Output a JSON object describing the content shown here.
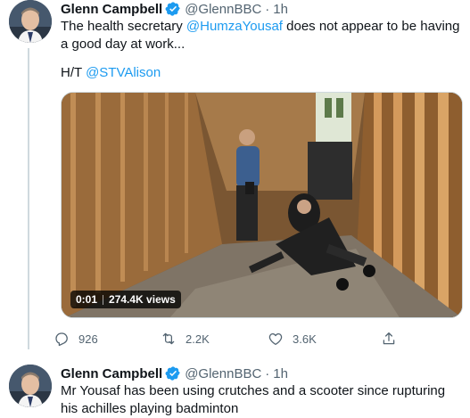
{
  "tweet1": {
    "author_name": "Glenn Campbell",
    "author_handle": "@GlennBBC",
    "separator": "·",
    "time": "1h",
    "text_part1": "The health secretary ",
    "text_mention1": "@HumzaYousaf",
    "text_part2": " does not appear to be having a good day at work...",
    "hat_tip_prefix": "H/T ",
    "hat_tip_mention": "@STVAlison",
    "video": {
      "duration": "0:01",
      "views": "274.4K views"
    },
    "actions": {
      "reply_count": "926",
      "retweet_count": "2.2K",
      "like_count": "3.6K"
    }
  },
  "tweet2": {
    "author_name": "Glenn Campbell",
    "author_handle": "@GlennBBC",
    "separator": "·",
    "time": "1h",
    "text": "Mr Yousaf has been using crutches and a scooter since rupturing his achilles playing badminton"
  },
  "colors": {
    "accent": "#1d9bf0",
    "text": "#0f1419",
    "secondary": "#536471",
    "border": "#cfd9de"
  },
  "icons": [
    "verified-badge-icon",
    "reply-icon",
    "retweet-icon",
    "like-icon",
    "share-icon"
  ]
}
